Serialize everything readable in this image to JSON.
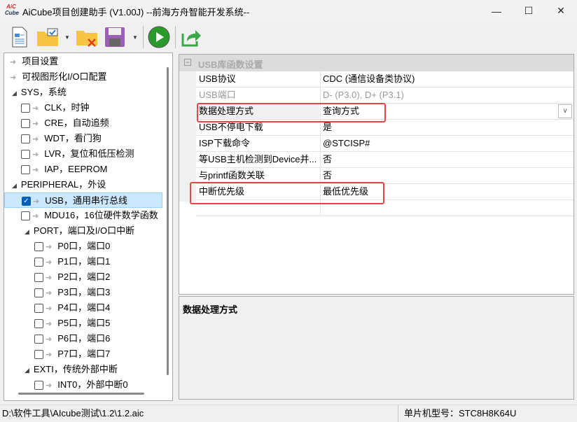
{
  "window": {
    "title": "AiCube项目创建助手 (V1.00J) --前海方舟智能开发系统--",
    "logo_top": "AiC",
    "logo_bottom": "Cube",
    "minimize": "—",
    "maximize": "☐",
    "close": "✕"
  },
  "toolbar": {
    "icons": [
      "new-document-icon",
      "open-project-icon",
      "close-project-icon",
      "save-icon",
      "run-icon",
      "export-icon"
    ]
  },
  "tree": {
    "items": [
      {
        "label": "项目设置",
        "type": "leaf",
        "level": 0
      },
      {
        "label": "可视图形化I/O口配置",
        "type": "leaf",
        "level": 0
      },
      {
        "label": "SYS，系统",
        "type": "group",
        "level": 0
      },
      {
        "label": "CLK，时钟",
        "type": "check",
        "level": 1,
        "checked": false
      },
      {
        "label": "CRE，自动追频",
        "type": "check",
        "level": 1,
        "checked": false
      },
      {
        "label": "WDT，看门狗",
        "type": "check",
        "level": 1,
        "checked": false
      },
      {
        "label": "LVR，复位和低压检测",
        "type": "check",
        "level": 1,
        "checked": false
      },
      {
        "label": "IAP，EEPROM",
        "type": "check",
        "level": 1,
        "checked": false
      },
      {
        "label": "PERIPHERAL，外设",
        "type": "group",
        "level": 0
      },
      {
        "label": "USB，通用串行总线",
        "type": "check",
        "level": 1,
        "checked": true,
        "selected": true
      },
      {
        "label": "MDU16，16位硬件数学函数",
        "type": "check",
        "level": 1,
        "checked": false
      },
      {
        "label": "PORT，端口及I/O口中断",
        "type": "group",
        "level": 1
      },
      {
        "label": "P0口，端口0",
        "type": "check",
        "level": 2,
        "checked": false
      },
      {
        "label": "P1口，端口1",
        "type": "check",
        "level": 2,
        "checked": false
      },
      {
        "label": "P2口，端口2",
        "type": "check",
        "level": 2,
        "checked": false
      },
      {
        "label": "P3口，端口3",
        "type": "check",
        "level": 2,
        "checked": false
      },
      {
        "label": "P4口，端口4",
        "type": "check",
        "level": 2,
        "checked": false
      },
      {
        "label": "P5口，端口5",
        "type": "check",
        "level": 2,
        "checked": false
      },
      {
        "label": "P6口，端口6",
        "type": "check",
        "level": 2,
        "checked": false
      },
      {
        "label": "P7口，端口7",
        "type": "check",
        "level": 2,
        "checked": false
      },
      {
        "label": "EXTI，传统外部中断",
        "type": "group",
        "level": 1
      },
      {
        "label": "INT0，外部中断0",
        "type": "check",
        "level": 2,
        "checked": false
      }
    ]
  },
  "properties": {
    "category": "USB库函数设置",
    "rows": [
      {
        "key": "USB协议",
        "value": "CDC (通信设备类协议)"
      },
      {
        "key": "USB端口",
        "value": "D- (P3.0), D+ (P3.1)",
        "disabled": true
      },
      {
        "key": "数据处理方式",
        "value": "查询方式",
        "selected": true
      },
      {
        "key": "USB不停电下载",
        "value": "是"
      },
      {
        "key": "ISP下载命令",
        "value": "@STCISP#"
      },
      {
        "key": "等USB主机检测到Device并...",
        "value": "否"
      },
      {
        "key": "与printf函数关联",
        "value": "否"
      },
      {
        "key": "中断优先级",
        "value": "最低优先级"
      }
    ],
    "dropdown_glyph": "∨"
  },
  "description": {
    "title": "数据处理方式"
  },
  "status": {
    "path": "D:\\软件工具\\AIcube测试\\1.2\\1.2.aic",
    "chip": "单片机型号：STC8H8K64U"
  },
  "colors": {
    "highlight": "#e04848",
    "selection": "#cce8ff",
    "check": "#005fb8"
  }
}
